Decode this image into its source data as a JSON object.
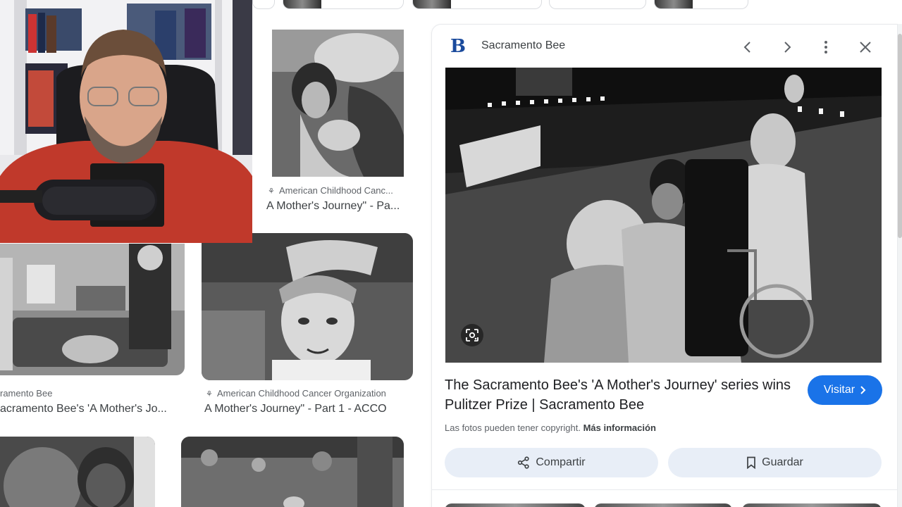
{
  "results": [
    {
      "source": "American Childhood Canc...",
      "caption": "A Mother's Journey\" - Pa..."
    },
    {
      "source": "ramento Bee",
      "caption": "acramento Bee's 'A Mother's Jo..."
    },
    {
      "source": "American Childhood Cancer Organization",
      "caption": "A Mother's Journey\" - Part 1 - ACCO"
    }
  ],
  "panel": {
    "site_logo_letter": "B",
    "site_name": "Sacramento Bee",
    "title": "The Sacramento Bee's 'A Mother's Journey' series wins Pulitzer Prize | Sacramento Bee",
    "visit_label": "Visitar",
    "copyright_text": "Las fotos pueden tener copyright.",
    "more_info_label": "Más información",
    "share_label": "Compartir",
    "save_label": "Guardar"
  },
  "colors": {
    "accent": "#1a73e8",
    "action_bg": "#e8eef7",
    "logo": "#1a4a9c"
  },
  "icons": [
    "chevron-left-icon",
    "chevron-right-icon",
    "more-vert-icon",
    "close-icon",
    "lens-icon",
    "share-icon",
    "bookmark-icon",
    "favicon-icon"
  ]
}
